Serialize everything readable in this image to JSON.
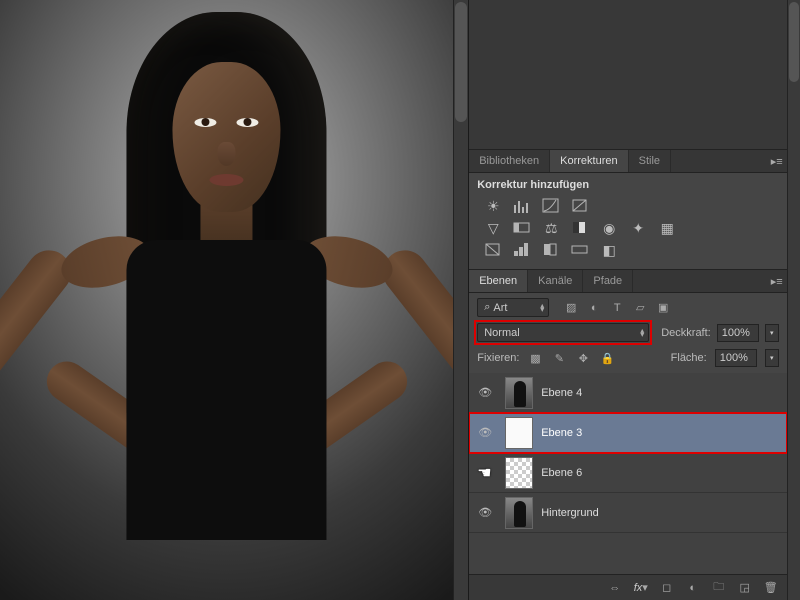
{
  "tabs_adjust": {
    "lib": "Bibliotheken",
    "corr": "Korrekturen",
    "styles": "Stile"
  },
  "adjust_subtitle": "Korrektur hinzufügen",
  "tabs_layers": {
    "layers": "Ebenen",
    "channels": "Kanäle",
    "paths": "Pfade"
  },
  "filter": {
    "label": "Art",
    "icon": "⌕"
  },
  "blend": {
    "mode": "Normal",
    "opacity_lbl": "Deckkraft:",
    "opacity_val": "100%"
  },
  "lock": {
    "label": "Fixieren:",
    "fill_lbl": "Fläche:",
    "fill_val": "100%"
  },
  "layers": [
    {
      "name": "Ebene 4",
      "vis": true,
      "thumb": "img",
      "sel": false
    },
    {
      "name": "Ebene 3",
      "vis": true,
      "thumb": "white",
      "sel": true,
      "red": true
    },
    {
      "name": "Ebene 6",
      "vis": false,
      "thumb": "trans",
      "sel": false,
      "hand": true
    },
    {
      "name": "Hintergrund",
      "vis": true,
      "thumb": "img",
      "sel": false
    }
  ],
  "bottom_icons": [
    "link",
    "fx",
    "mask",
    "adj",
    "group",
    "new",
    "trash"
  ]
}
